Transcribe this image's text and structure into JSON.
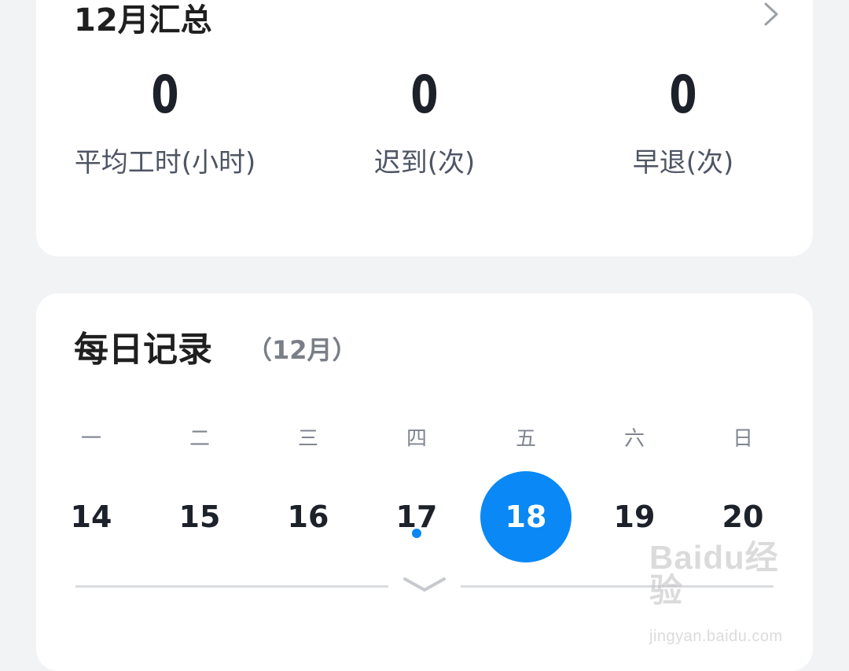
{
  "summary": {
    "title": "12月汇总",
    "stats": [
      {
        "value": "0",
        "label": "平均工时(小时)"
      },
      {
        "value": "0",
        "label": "迟到(次)"
      },
      {
        "value": "0",
        "label": "早退(次)"
      }
    ]
  },
  "daily": {
    "title": "每日记录",
    "subtitle": "（12月）",
    "weekdays": [
      "一",
      "二",
      "三",
      "四",
      "五",
      "六",
      "日"
    ],
    "days": [
      "14",
      "15",
      "16",
      "17",
      "18",
      "19",
      "20"
    ],
    "selected_day": "18",
    "marked_day": "17"
  },
  "watermark": {
    "main": "Baidu经验",
    "sub": "jingyan.baidu.com"
  },
  "colors": {
    "accent": "#0a88f5",
    "background": "#f2f3f5",
    "card": "#ffffff"
  },
  "icons": {
    "summary_chevron": "chevron-right-icon",
    "expand": "chevron-down-icon"
  }
}
